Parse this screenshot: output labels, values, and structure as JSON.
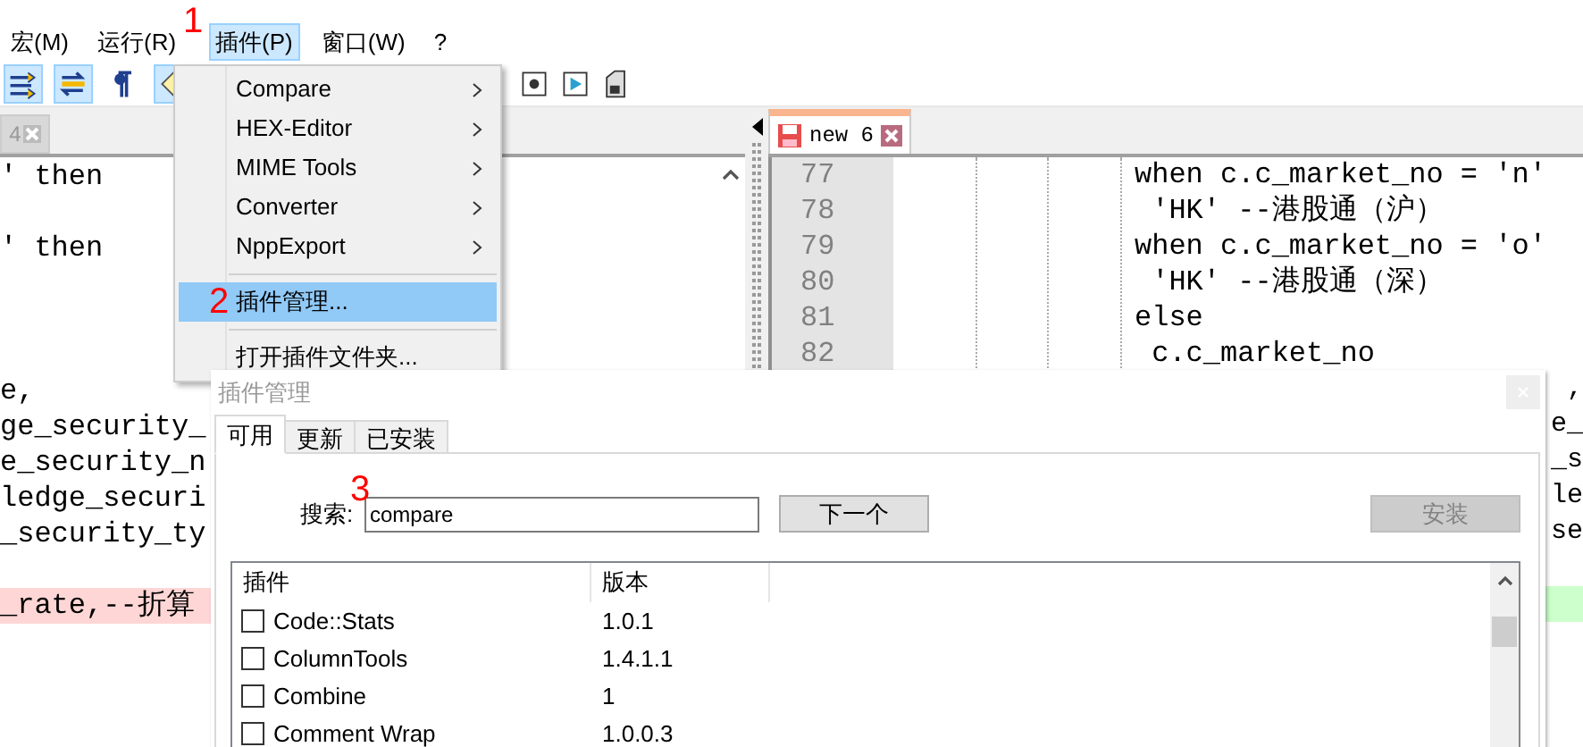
{
  "menubar": [
    {
      "label": "宏(M)",
      "selected": false
    },
    {
      "label": "运行(R)",
      "selected": false
    },
    {
      "label": "插件(P)",
      "selected": true,
      "annotation": "1"
    },
    {
      "label": "窗口(W)",
      "selected": false
    },
    {
      "label": "?",
      "selected": false
    }
  ],
  "toolbar": {
    "left": [
      {
        "kind": "wrap",
        "pressed": true
      },
      {
        "kind": "sync",
        "pressed": true
      },
      {
        "kind": "pilcrow",
        "pressed": false
      },
      {
        "kind": "guide",
        "pressed": true
      }
    ],
    "right": [
      {
        "kind": "record",
        "pressed": false
      },
      {
        "kind": "play",
        "pressed": false
      },
      {
        "kind": "save-macro",
        "pressed": false
      }
    ]
  },
  "left_pane": {
    "tab": {
      "label": "4",
      "selected": false
    },
    "lines": [
      {
        "text": "' then",
        "highlighted": false
      },
      {
        "highlighted": false
      },
      {
        "text": "' then",
        "highlighted": false
      },
      {
        "highlighted": false
      },
      {
        "highlighted": false
      },
      {
        "highlighted": false
      },
      {
        "text": "e,",
        "highlighted": false
      },
      {
        "text": "ge_security_",
        "highlighted": false
      },
      {
        "text": "e_security_n",
        "highlighted": false
      },
      {
        "text": "ledge_securi",
        "highlighted": false
      },
      {
        "text": "_security_ty",
        "highlighted": false
      },
      {
        "highlighted": false
      },
      {
        "text": "_rate,--折算",
        "highlighted": true
      }
    ]
  },
  "right_pane": {
    "tab": {
      "label": "new 6",
      "selected": true
    },
    "lines": [
      {
        "number": "77",
        "text": "when c.c_market_no = 'n'"
      },
      {
        "number": "78",
        "text": " 'HK' --港股通（沪）"
      },
      {
        "number": "79",
        "text": "when c.c_market_no = 'o'"
      },
      {
        "number": "80",
        "text": " 'HK' --港股通（深）"
      },
      {
        "number": "81",
        "text": "else"
      },
      {
        "number": "82",
        "text": " c.c_market_no"
      }
    ],
    "edge_lines": [
      {
        "text": ",",
        "highlighted": false
      },
      {
        "text": "e_",
        "highlighted": false
      },
      {
        "text": "_s",
        "highlighted": false
      },
      {
        "text": "le",
        "highlighted": false
      },
      {
        "text": "se",
        "highlighted": false
      },
      {
        "highlighted": false
      },
      {
        "highlighted": true
      }
    ]
  },
  "plugin_menu": {
    "groups": [
      [
        {
          "label": "Compare",
          "kind": "submenu",
          "selected": false
        },
        {
          "label": "HEX-Editor",
          "kind": "submenu",
          "selected": false
        },
        {
          "label": "MIME Tools",
          "kind": "submenu",
          "selected": false
        },
        {
          "label": "Converter",
          "kind": "submenu",
          "selected": false
        },
        {
          "label": "NppExport",
          "kind": "submenu",
          "selected": false
        }
      ],
      [
        {
          "label": "插件管理...",
          "kind": "command",
          "selected": true,
          "annotation": "2"
        }
      ],
      [
        {
          "label": "打开插件文件夹...",
          "kind": "command",
          "selected": false
        }
      ]
    ]
  },
  "dialog": {
    "title": "插件管理",
    "tabs": [
      {
        "label": "可用",
        "selected": true
      },
      {
        "label": "更新",
        "selected": false
      },
      {
        "label": "已安装",
        "selected": false
      }
    ],
    "search": {
      "label": "搜索:",
      "value": "compare",
      "annotation": "3"
    },
    "buttons": [
      {
        "label": "下一个",
        "disabled": false
      },
      {
        "label": "安装",
        "disabled": true
      }
    ],
    "columns": [
      "插件",
      "版本"
    ],
    "rows": [
      {
        "name": "Code::Stats",
        "version": "1.0.1",
        "checked": false
      },
      {
        "name": "ColumnTools",
        "version": "1.4.1.1",
        "checked": false
      },
      {
        "name": "Combine",
        "version": "1",
        "checked": false
      },
      {
        "name": "Comment Wrap",
        "version": "1.0.0.3",
        "checked": false
      }
    ]
  }
}
